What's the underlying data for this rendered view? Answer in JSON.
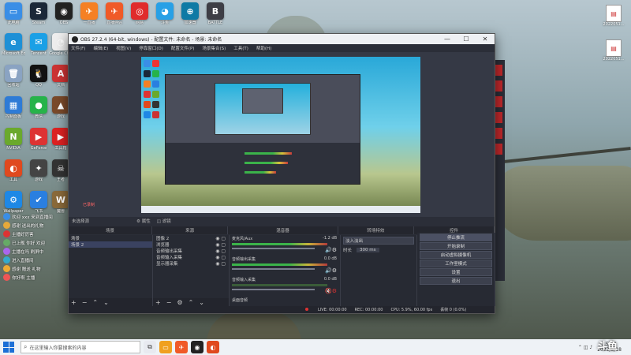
{
  "desktop": {
    "icons_row1": [
      {
        "label": "此电脑",
        "color": "#3a8ee6",
        "glyph": "▭",
        "icon": "computer-icon"
      },
      {
        "label": "Steam",
        "color": "#1b2838",
        "glyph": "S",
        "icon": "steam-icon"
      },
      {
        "label": "OBS",
        "color": "#222",
        "glyph": "◉",
        "icon": "obs-icon"
      },
      {
        "label": "一直播",
        "color": "#f58024",
        "glyph": "✈",
        "icon": "live-icon"
      },
      {
        "label": "直播伴侣",
        "color": "#f05a28",
        "glyph": "✈",
        "icon": "live2-icon"
      },
      {
        "label": "网易",
        "color": "#e02b2b",
        "glyph": "◎",
        "icon": "netease-icon"
      },
      {
        "label": "斗鱼",
        "color": "#28a0e6",
        "glyph": "◕",
        "icon": "douyu-icon"
      },
      {
        "label": "加速器",
        "color": "#0e7aa5",
        "glyph": "⊕",
        "icon": "accelerator-icon"
      },
      {
        "label": "BATTLE",
        "color": "#3e3e46",
        "glyph": "B",
        "icon": "battle-icon"
      }
    ],
    "icons_col1": [
      {
        "label": "Microsoft Edge",
        "color": "#1e90d6",
        "glyph": "e",
        "icon": "edge-icon"
      },
      {
        "label": "回收站",
        "color": "#8aa3c2",
        "glyph": "🗑",
        "icon": "recycle-bin-icon"
      },
      {
        "label": "控制面板",
        "color": "#2e7bd6",
        "glyph": "▦",
        "icon": "control-panel-icon"
      },
      {
        "label": "NVIDIA",
        "color": "#6aa92c",
        "glyph": "N",
        "icon": "nvidia-icon"
      },
      {
        "label": "工具",
        "color": "#e0491e",
        "glyph": "◐",
        "icon": "tool-icon"
      },
      {
        "label": "Wallpaper",
        "color": "#1e88e5",
        "glyph": "⚙",
        "icon": "wallpaper-icon"
      }
    ],
    "icons_col2": [
      {
        "label": "Tencent",
        "color": "#1aa0e6",
        "glyph": "✉",
        "icon": "tencent-icon"
      },
      {
        "label": "QQ",
        "color": "#111",
        "glyph": "🐧",
        "icon": "qq-icon"
      },
      {
        "label": "微信",
        "color": "#26b34a",
        "glyph": "●",
        "icon": "wechat-icon"
      },
      {
        "label": "GeForce",
        "color": "#d33",
        "glyph": "▶",
        "icon": "geforce-icon"
      },
      {
        "label": "游戏",
        "color": "#444",
        "glyph": "✦",
        "icon": "game-icon"
      },
      {
        "label": "飞书",
        "color": "#2a7fe0",
        "glyph": "✔",
        "icon": "feishu-icon"
      }
    ],
    "icons_col3": [
      {
        "label": "Google Chrome",
        "color": "#eee",
        "glyph": "◔",
        "icon": "chrome-icon"
      },
      {
        "label": "文档",
        "color": "#c33",
        "glyph": "A",
        "icon": "pdf-icon"
      },
      {
        "label": "游戏",
        "color": "#7a4a2a",
        "glyph": "▲",
        "icon": "game2-icon"
      },
      {
        "label": "工具箱",
        "color": "#d22",
        "glyph": "▶",
        "icon": "toolbox-icon"
      },
      {
        "label": "王者",
        "color": "#333",
        "glyph": "☠",
        "icon": "wangzhe-icon"
      },
      {
        "label": "魔兽",
        "color": "#8a6a3a",
        "glyph": "W",
        "icon": "warcraft-icon"
      }
    ],
    "right_files": [
      {
        "label": "2022051..."
      },
      {
        "label": "2022051..."
      }
    ],
    "watermark": "斗鱼"
  },
  "obs": {
    "title": "OBS 27.2.4 (64-bit, windows) - 配置文件: 未命名 - 场景: 未命名",
    "menu": [
      "文件(F)",
      "编辑(E)",
      "视图(V)",
      "停靠窗口(D)",
      "配置文件(P)",
      "场景集合(S)",
      "工具(T)",
      "帮助(H)"
    ],
    "window_controls": [
      "—",
      "☐",
      "✕"
    ],
    "no_source_label": "未选择源",
    "properties_button": "属性",
    "filters_button": "滤镜",
    "dock_titles": [
      "场景",
      "来源",
      "混音器",
      "转场特效",
      "控件"
    ],
    "scenes": [
      "场景",
      "场景 2"
    ],
    "sources": [
      {
        "name": "图像 2"
      },
      {
        "name": "浏览器"
      },
      {
        "name": "音频输出采集"
      },
      {
        "name": "音频输入采集"
      },
      {
        "name": "显示器采集"
      }
    ],
    "mixer": [
      {
        "name": "麦克风/Aux",
        "db": "-1.2 dB"
      },
      {
        "name": "音频输出采集",
        "db": "0.0 dB"
      },
      {
        "name": "音频输入采集",
        "db": "0.0 dB"
      },
      {
        "name": "桌面音频",
        "db": ""
      }
    ],
    "transition": {
      "type": "淡入淡出",
      "duration_label": "时长",
      "duration": "300 ms"
    },
    "controls": [
      "停止推流",
      "开始录制",
      "启动虚拟摄像机",
      "工作室模式",
      "设置",
      "退出"
    ],
    "status": {
      "live": "LIVE: 00:00:00",
      "rec": "REC: 00:00:00",
      "cpu": "CPU: 5.9%, 60.00 fps",
      "dropped": "丢帧 0 (0.0%)"
    },
    "recording_label": "已录制"
  },
  "chat": [
    {
      "text": "欢迎 xxx 来到直播间",
      "color": "#3a8ee6"
    },
    {
      "text": "感谢 送出的礼物",
      "color": "#e6a93a"
    },
    {
      "text": "主播好厉害",
      "color": "#d33"
    },
    {
      "text": "已上舰 你好 欢迎",
      "color": "#6a6"
    },
    {
      "text": "主播在吗 刷屏中",
      "color": "#a6e"
    },
    {
      "text": "进入直播间",
      "color": "#3ac"
    },
    {
      "text": "感谢 赠送 礼物",
      "color": "#ea3"
    },
    {
      "text": "你好啊 主播",
      "color": "#e55"
    }
  ],
  "taskbar": {
    "search_placeholder": "在这里输入你要搜索的内容",
    "time": "15:23",
    "date": "2022/5/18"
  }
}
